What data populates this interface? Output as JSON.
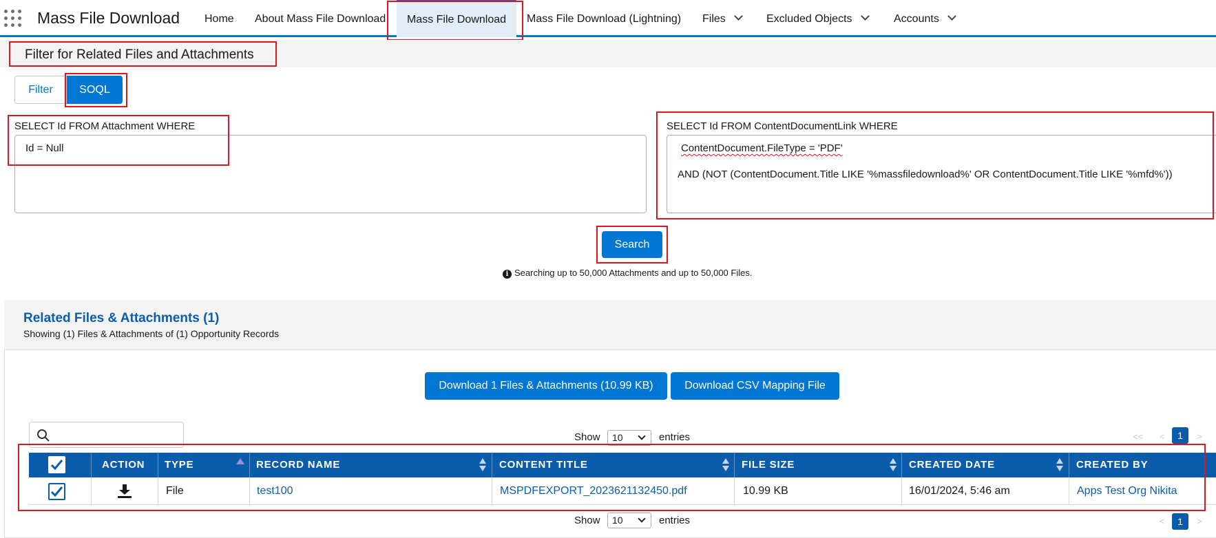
{
  "app": {
    "name": "Mass File Download",
    "nav": [
      {
        "label": "Home"
      },
      {
        "label": "About Mass File Download"
      },
      {
        "label": "Mass File Download"
      },
      {
        "label": "Mass File Download (Lightning)"
      },
      {
        "label": "Files"
      },
      {
        "label": "Excluded Objects"
      },
      {
        "label": "Accounts"
      }
    ],
    "active_nav": "Mass File Download"
  },
  "filter": {
    "title": "Filter for Related Files and Attachments",
    "tabs": [
      "Filter",
      "SOQL"
    ],
    "active_tab": "SOQL",
    "attachment_label": "SELECT Id FROM Attachment WHERE",
    "attachment_query": "Id = Null",
    "content_label": "SELECT Id FROM ContentDocumentLink WHERE",
    "content_query_line1": "ContentDocument.FileType = 'PDF'",
    "content_query_line2": "AND (NOT (ContentDocument.Title LIKE '%massfiledownload%' OR ContentDocument.Title LIKE '%mfd%'))",
    "search_label": "Search",
    "info_note": "Searching up to 50,000 Attachments and up to 50,000 Files."
  },
  "results": {
    "title": "Related Files & Attachments (1)",
    "subtitle": "Showing (1) Files & Attachments of (1) Opportunity Records",
    "download_button": "Download 1 Files & Attachments (10.99 KB)",
    "csv_button": "Download CSV Mapping File",
    "show_label": "Show",
    "entries_label": "entries",
    "page_size": "10",
    "pager_first": "<<",
    "pager_prev": "<",
    "pager_next": ">",
    "current_page": "1",
    "columns": [
      "ACTION",
      "TYPE",
      "RECORD NAME",
      "CONTENT TITLE",
      "FILE SIZE",
      "CREATED DATE",
      "CREATED BY"
    ],
    "rows": [
      {
        "selected": true,
        "type": "File",
        "record_name": "test100",
        "content_title": "MSPDFEXPORT_2023621132450.pdf",
        "file_size": "10.99 KB",
        "created_date": "16/01/2024, 5:46 am",
        "created_by": "Apps Test Org Nikita"
      }
    ]
  },
  "colors": {
    "brand": "#0176d3",
    "table_header": "#0b5cab",
    "highlight": "#e0141e"
  }
}
